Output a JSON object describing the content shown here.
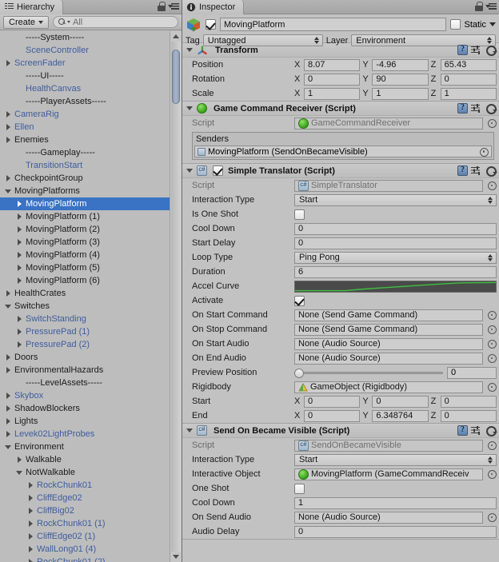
{
  "hierarchy": {
    "tab_label": "Hierarchy",
    "create_label": "Create",
    "search_value": "All",
    "search_placeholder": "All",
    "items": [
      {
        "label": "-----System-----",
        "indent": 1,
        "arrow": "none",
        "prefab": false,
        "selected": false
      },
      {
        "label": "SceneController",
        "indent": 1,
        "arrow": "none",
        "prefab": true,
        "selected": false
      },
      {
        "label": "ScreenFader",
        "indent": 0,
        "arrow": "closed",
        "prefab": true,
        "selected": false
      },
      {
        "label": "-----UI-----",
        "indent": 1,
        "arrow": "none",
        "prefab": false,
        "selected": false
      },
      {
        "label": "HealthCanvas",
        "indent": 1,
        "arrow": "none",
        "prefab": true,
        "selected": false
      },
      {
        "label": "-----PlayerAssets-----",
        "indent": 1,
        "arrow": "none",
        "prefab": false,
        "selected": false
      },
      {
        "label": "CameraRig",
        "indent": 0,
        "arrow": "closed",
        "prefab": true,
        "selected": false
      },
      {
        "label": "Ellen",
        "indent": 0,
        "arrow": "closed",
        "prefab": true,
        "selected": false
      },
      {
        "label": "Enemies",
        "indent": 0,
        "arrow": "closed",
        "prefab": false,
        "selected": false
      },
      {
        "label": "-----Gameplay-----",
        "indent": 1,
        "arrow": "none",
        "prefab": false,
        "selected": false
      },
      {
        "label": "TransitionStart",
        "indent": 1,
        "arrow": "none",
        "prefab": true,
        "selected": false
      },
      {
        "label": "CheckpointGroup",
        "indent": 0,
        "arrow": "closed",
        "prefab": false,
        "selected": false
      },
      {
        "label": "MovingPlatforms",
        "indent": 0,
        "arrow": "open",
        "prefab": false,
        "selected": false
      },
      {
        "label": "MovingPlatform",
        "indent": 1,
        "arrow": "closed",
        "prefab": false,
        "selected": true
      },
      {
        "label": "MovingPlatform (1)",
        "indent": 1,
        "arrow": "closed",
        "prefab": false,
        "selected": false
      },
      {
        "label": "MovingPlatform (2)",
        "indent": 1,
        "arrow": "closed",
        "prefab": false,
        "selected": false
      },
      {
        "label": "MovingPlatform (3)",
        "indent": 1,
        "arrow": "closed",
        "prefab": false,
        "selected": false
      },
      {
        "label": "MovingPlatform (4)",
        "indent": 1,
        "arrow": "closed",
        "prefab": false,
        "selected": false
      },
      {
        "label": "MovingPlatform (5)",
        "indent": 1,
        "arrow": "closed",
        "prefab": false,
        "selected": false
      },
      {
        "label": "MovingPlatform (6)",
        "indent": 1,
        "arrow": "closed",
        "prefab": false,
        "selected": false
      },
      {
        "label": "HealthCrates",
        "indent": 0,
        "arrow": "closed",
        "prefab": false,
        "selected": false
      },
      {
        "label": "Switches",
        "indent": 0,
        "arrow": "open",
        "prefab": false,
        "selected": false
      },
      {
        "label": "SwitchStanding",
        "indent": 1,
        "arrow": "closed",
        "prefab": true,
        "selected": false
      },
      {
        "label": "PressurePad (1)",
        "indent": 1,
        "arrow": "closed",
        "prefab": true,
        "selected": false
      },
      {
        "label": "PressurePad (2)",
        "indent": 1,
        "arrow": "closed",
        "prefab": true,
        "selected": false
      },
      {
        "label": "Doors",
        "indent": 0,
        "arrow": "closed",
        "prefab": false,
        "selected": false
      },
      {
        "label": "EnvironmentalHazards",
        "indent": 0,
        "arrow": "closed",
        "prefab": false,
        "selected": false
      },
      {
        "label": "-----LevelAssets-----",
        "indent": 1,
        "arrow": "none",
        "prefab": false,
        "selected": false
      },
      {
        "label": "Skybox",
        "indent": 0,
        "arrow": "closed",
        "prefab": true,
        "selected": false
      },
      {
        "label": "ShadowBlockers",
        "indent": 0,
        "arrow": "closed",
        "prefab": false,
        "selected": false
      },
      {
        "label": "Lights",
        "indent": 0,
        "arrow": "closed",
        "prefab": false,
        "selected": false
      },
      {
        "label": "Levek02LightProbes",
        "indent": 0,
        "arrow": "closed",
        "prefab": true,
        "selected": false
      },
      {
        "label": "Environment",
        "indent": 0,
        "arrow": "open",
        "prefab": false,
        "selected": false
      },
      {
        "label": "Walkable",
        "indent": 1,
        "arrow": "closed",
        "prefab": false,
        "selected": false
      },
      {
        "label": "NotWalkable",
        "indent": 1,
        "arrow": "open",
        "prefab": false,
        "selected": false
      },
      {
        "label": "RockChunk01",
        "indent": 2,
        "arrow": "closed",
        "prefab": true,
        "selected": false
      },
      {
        "label": "CliffEdge02",
        "indent": 2,
        "arrow": "closed",
        "prefab": true,
        "selected": false
      },
      {
        "label": "CliffBig02",
        "indent": 2,
        "arrow": "closed",
        "prefab": true,
        "selected": false
      },
      {
        "label": "RockChunk01 (1)",
        "indent": 2,
        "arrow": "closed",
        "prefab": true,
        "selected": false
      },
      {
        "label": "CliffEdge02 (1)",
        "indent": 2,
        "arrow": "closed",
        "prefab": true,
        "selected": false
      },
      {
        "label": "WallLong01 (4)",
        "indent": 2,
        "arrow": "closed",
        "prefab": true,
        "selected": false
      },
      {
        "label": "RockChunk01 (2)",
        "indent": 2,
        "arrow": "closed",
        "prefab": true,
        "selected": false
      }
    ]
  },
  "inspector": {
    "tab_label": "Inspector",
    "object_name": "MovingPlatform",
    "enabled": true,
    "static_label": "Static",
    "static_checked": false,
    "tag_label": "Tag",
    "tag_value": "Untagged",
    "layer_label": "Layer",
    "layer_value": "Environment",
    "components": [
      {
        "title": "Transform",
        "icon": "transform-axis-icon",
        "has_enable_checkbox": false,
        "rows": [
          {
            "type": "vector3",
            "label": "Position",
            "x": "8.07",
            "y": "-4.96",
            "z": "65.43"
          },
          {
            "type": "vector3",
            "label": "Rotation",
            "x": "0",
            "y": "90",
            "z": "0"
          },
          {
            "type": "vector3",
            "label": "Scale",
            "x": "1",
            "y": "1",
            "z": "1"
          }
        ]
      },
      {
        "title": "Game Command Receiver (Script)",
        "icon": "green-ball-icon",
        "has_enable_checkbox": false,
        "rows": [
          {
            "type": "object_ro",
            "label": "Script",
            "value": "GameCommandReceiver",
            "icon": "green-ball-icon"
          },
          {
            "type": "list",
            "label": "Senders",
            "items": [
              {
                "value": "MovingPlatform (SendOnBecameVisible)",
                "icon": "cs-script-icon"
              }
            ]
          }
        ]
      },
      {
        "title": "Simple Translator (Script)",
        "icon": "cs-script-icon",
        "has_enable_checkbox": true,
        "enabled": true,
        "rows": [
          {
            "type": "object_ro",
            "label": "Script",
            "value": "SimpleTranslator",
            "icon": "cs-script-icon"
          },
          {
            "type": "dropdown",
            "label": "Interaction Type",
            "value": "Start"
          },
          {
            "type": "checkbox",
            "label": "Is One Shot",
            "checked": false
          },
          {
            "type": "text",
            "label": "Cool Down",
            "value": "0"
          },
          {
            "type": "text",
            "label": "Start Delay",
            "value": "0"
          },
          {
            "type": "dropdown",
            "label": "Loop Type",
            "value": "Ping Pong"
          },
          {
            "type": "text",
            "label": "Duration",
            "value": "6"
          },
          {
            "type": "curve",
            "label": "Accel Curve"
          },
          {
            "type": "checkbox",
            "label": "Activate",
            "checked": true
          },
          {
            "type": "object",
            "label": "On Start Command",
            "value": "None (Send Game Command)"
          },
          {
            "type": "object",
            "label": "On Stop Command",
            "value": "None (Send Game Command)"
          },
          {
            "type": "object",
            "label": "On Start Audio",
            "value": "None (Audio Source)"
          },
          {
            "type": "object",
            "label": "On End Audio",
            "value": "None (Audio Source)"
          },
          {
            "type": "slider",
            "label": "Preview Position",
            "value": "0",
            "percent": 0
          },
          {
            "type": "object",
            "label": "Rigidbody",
            "value": "GameObject (Rigidbody)",
            "icon": "rigidbody-icon"
          },
          {
            "type": "vector3",
            "label": "Start",
            "x": "0",
            "y": "0",
            "z": "0"
          },
          {
            "type": "vector3",
            "label": "End",
            "x": "0",
            "y": "6.348764",
            "z": "0"
          }
        ]
      },
      {
        "title": "Send On Became Visible (Script)",
        "icon": "cs-script-icon",
        "has_enable_checkbox": false,
        "rows": [
          {
            "type": "object_ro",
            "label": "Script",
            "value": "SendOnBecameVisible",
            "icon": "cs-script-icon"
          },
          {
            "type": "dropdown",
            "label": "Interaction Type",
            "value": "Start"
          },
          {
            "type": "object",
            "label": "Interactive Object",
            "value": "MovingPlatform (GameCommandReceiv",
            "icon": "green-ball-icon"
          },
          {
            "type": "checkbox",
            "label": "One Shot",
            "checked": false
          },
          {
            "type": "text",
            "label": "Cool Down",
            "value": "1"
          },
          {
            "type": "object",
            "label": "On Send Audio",
            "value": "None (Audio Source)"
          },
          {
            "type": "text",
            "label": "Audio Delay",
            "value": "0"
          }
        ]
      }
    ]
  },
  "colors": {
    "selection_blue": "#3a72c4",
    "prefab_blue": "#3e5d9e",
    "panel_bg": "#c2c2c2",
    "curve_green": "#3fbf3f",
    "curve_bg": "#4a4a4a"
  }
}
